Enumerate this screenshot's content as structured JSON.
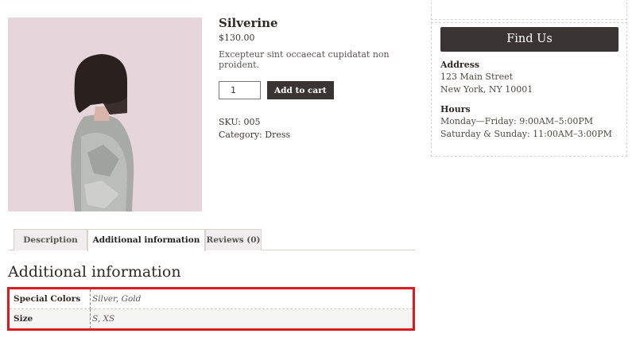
{
  "product": {
    "title": "Silverine",
    "price": "$130.00",
    "description": "Excepteur sint occaecat cupidatat non proident.",
    "quantity": "1",
    "add_to_cart_label": "Add to cart",
    "sku_label": "SKU:",
    "sku_value": "005",
    "category_label": "Category:",
    "category_value": "Dress"
  },
  "tabs": [
    {
      "label": "Description",
      "active": false
    },
    {
      "label": "Additional information",
      "active": true
    },
    {
      "label": "Reviews (0)",
      "active": false
    }
  ],
  "additional_info": {
    "title": "Additional information",
    "rows": [
      {
        "label": "Special Colors",
        "value": "Silver, Gold"
      },
      {
        "label": "Size",
        "value": "S, XS"
      }
    ]
  },
  "sidebar": {
    "widget_title": "Find Us",
    "address_heading": "Address",
    "address_lines": [
      "123 Main Street",
      "New York, NY 10001"
    ],
    "hours_heading": "Hours",
    "hours_lines": [
      "Monday—Friday: 9:00AM–5:00PM",
      "Saturday & Sunday: 11:00AM–3:00PM"
    ]
  },
  "colors": {
    "highlight_border": "#e0191f",
    "button_bg": "#3a3532",
    "image_bg": "#e7d8dd"
  }
}
